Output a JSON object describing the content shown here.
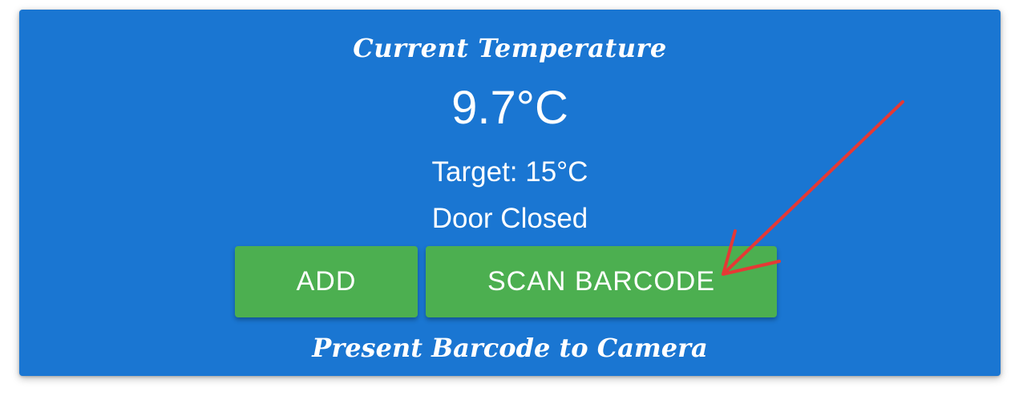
{
  "panel": {
    "title": "Current Temperature",
    "current_temperature": "9.7°C",
    "target": "Target: 15°C",
    "door_status": "Door Closed",
    "footer": "Present Barcode to Camera"
  },
  "buttons": {
    "add_label": "ADD",
    "scan_label": "SCAN BARCODE"
  },
  "colors": {
    "panel_background": "#1a76d2",
    "button_background": "#4caf50",
    "text": "#ffffff",
    "annotation_arrow": "#e53935"
  }
}
